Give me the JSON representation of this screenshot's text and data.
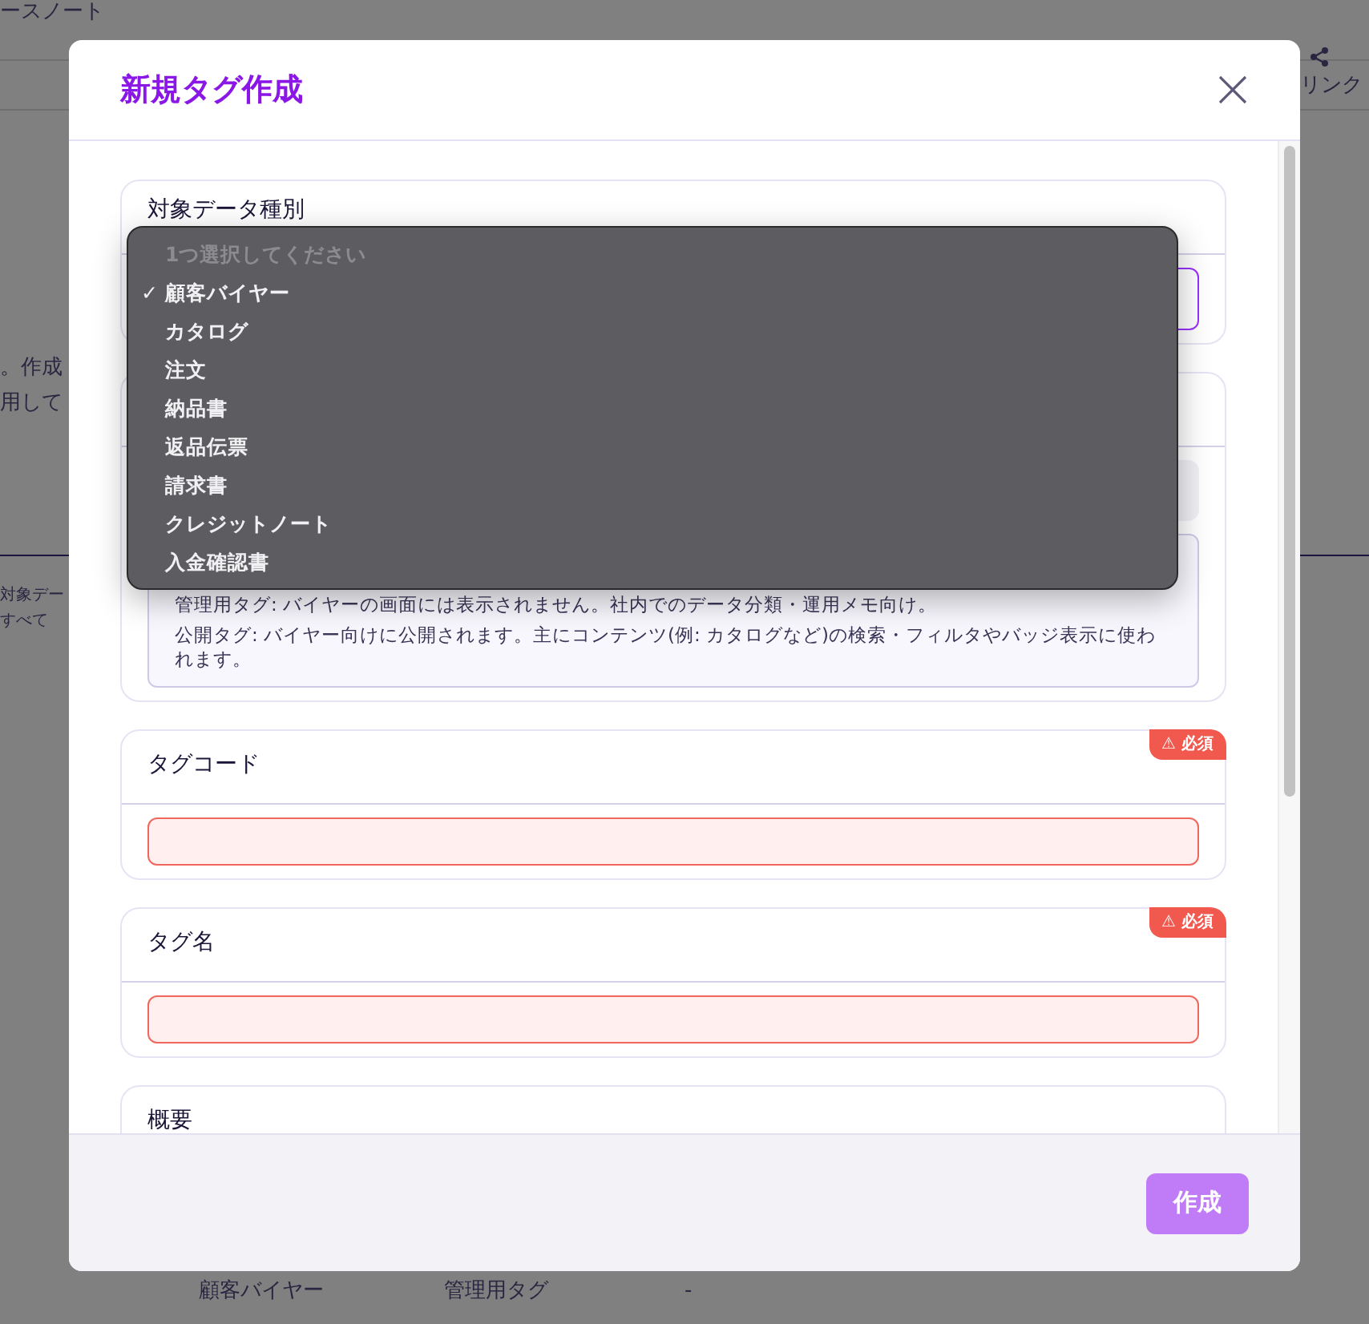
{
  "background": {
    "breadcrumb": "ースノート",
    "share_label": "リンク",
    "text_lines": [
      "。作成",
      "用して"
    ],
    "filter_label": "対象デー",
    "filter_value": "すべて",
    "table_row": [
      "顧客バイヤー",
      "管理用タグ",
      "-"
    ]
  },
  "modal": {
    "title": "新規タグ作成",
    "sections": [
      {
        "kind": "select",
        "label": "対象データ種別",
        "focused": true
      },
      {
        "kind": "visibility",
        "notes": [
          "管理用タグ: バイヤーの画面には表示されません。社内でのデータ分類・運用メモ向け。",
          "公開タグ: バイヤー向けに公開されます。主にコンテンツ(例: カタログなど)の検索・フィルタやバッジ表示に使われます。"
        ]
      },
      {
        "kind": "text",
        "label": "タグコード",
        "required": true,
        "badge": "⚠ 必須",
        "invalid": true
      },
      {
        "kind": "text",
        "label": "タグ名",
        "required": true,
        "badge": "⚠ 必須",
        "invalid": true
      },
      {
        "kind": "textarea",
        "label": "概要"
      }
    ],
    "dropdown": [
      {
        "label": "1つ選択してください",
        "disabled": true,
        "selected": false
      },
      {
        "label": "顧客バイヤー",
        "disabled": false,
        "selected": true
      },
      {
        "label": "カタログ",
        "disabled": false,
        "selected": false
      },
      {
        "label": "注文",
        "disabled": false,
        "selected": false
      },
      {
        "label": "納品書",
        "disabled": false,
        "selected": false
      },
      {
        "label": "返品伝票",
        "disabled": false,
        "selected": false
      },
      {
        "label": "請求書",
        "disabled": false,
        "selected": false
      },
      {
        "label": "クレジットノート",
        "disabled": false,
        "selected": false
      },
      {
        "label": "入金確認書",
        "disabled": false,
        "selected": false
      }
    ],
    "check_mark": "✓",
    "submit": {
      "label": "作成",
      "disabled": true
    }
  }
}
